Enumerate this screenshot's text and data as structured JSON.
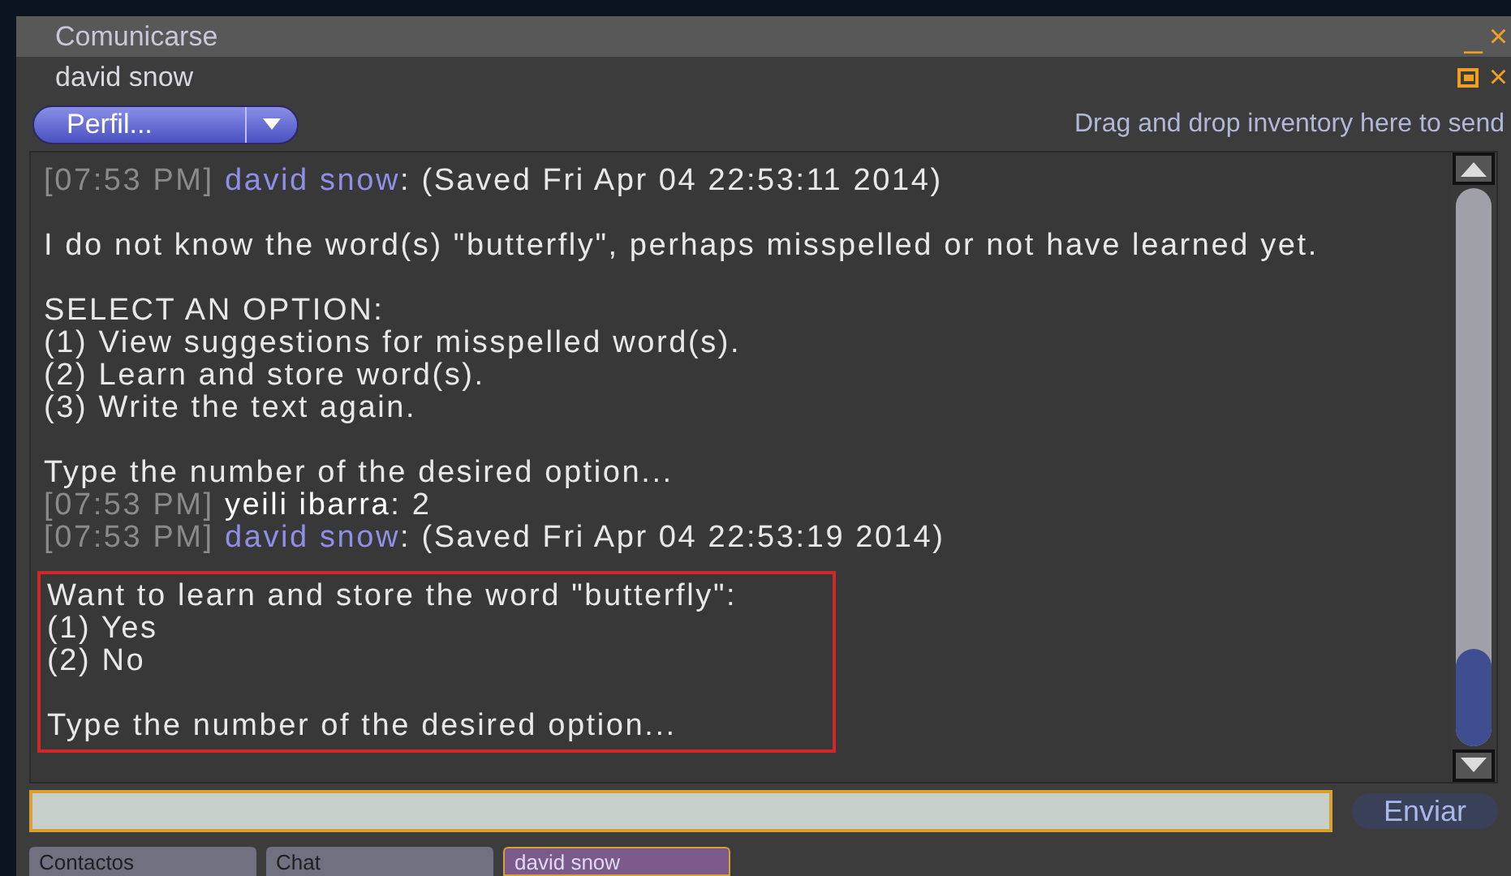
{
  "window": {
    "title": "Comunicarse",
    "minimize": "_",
    "close": "×"
  },
  "conversation": {
    "name": "david snow",
    "close": "×"
  },
  "profile_button": {
    "label": "Perfil..."
  },
  "drop_hint": "Drag and drop inventory here to send",
  "chat": {
    "blocks": [
      {
        "highlighted": false,
        "lines": [
          {
            "kind": "message",
            "time": "[07:53 PM]",
            "sender": "david snow",
            "color": "#8f8fe8",
            "text": ": (Saved Fri Apr 04 22:53:11 2014)"
          },
          {
            "kind": "gap"
          },
          {
            "kind": "text",
            "text": "I do not know the word(s) \"butterfly\", perhaps misspelled or not have learned yet."
          },
          {
            "kind": "gap"
          },
          {
            "kind": "text",
            "text": "SELECT AN OPTION:"
          },
          {
            "kind": "text",
            "text": "(1) View suggestions for misspelled word(s)."
          },
          {
            "kind": "text",
            "text": "(2) Learn and store word(s)."
          },
          {
            "kind": "text",
            "text": "(3) Write the text again."
          },
          {
            "kind": "gap"
          },
          {
            "kind": "text",
            "text": "Type the number of the desired option..."
          },
          {
            "kind": "message",
            "time": "[07:53 PM]",
            "sender": "yeili ibarra",
            "color": "#ffffff",
            "text": ": 2"
          },
          {
            "kind": "message",
            "time": "[07:53 PM]",
            "sender": "david snow",
            "color": "#8f8fe8",
            "text": ": (Saved Fri Apr 04 22:53:19 2014)"
          }
        ]
      },
      {
        "highlighted": true,
        "lines": [
          {
            "kind": "text",
            "text": "Want to learn and store the word \"butterfly\":"
          },
          {
            "kind": "text",
            "text": "(1) Yes"
          },
          {
            "kind": "text",
            "text": "(2) No"
          },
          {
            "kind": "gap"
          },
          {
            "kind": "text",
            "text": "Type the number of the desired option..."
          }
        ]
      }
    ]
  },
  "send_button": {
    "label": "Enviar"
  },
  "tabs": [
    {
      "label": "Contactos",
      "selected": false
    },
    {
      "label": "Chat",
      "selected": false
    },
    {
      "label": "david snow",
      "selected": true
    }
  ]
}
